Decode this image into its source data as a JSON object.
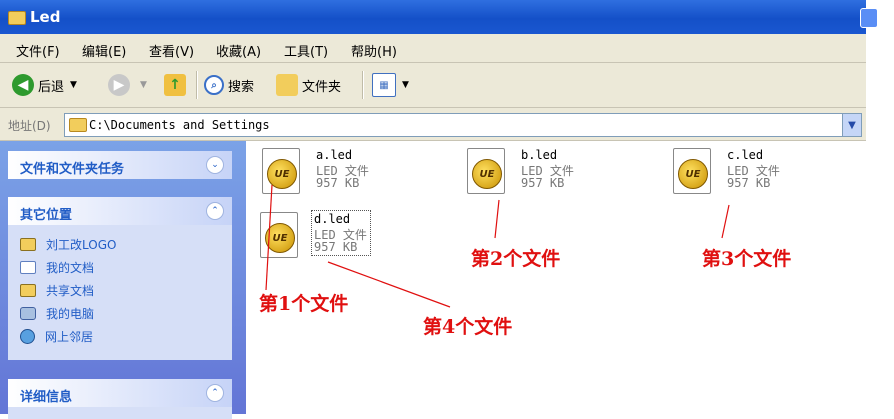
{
  "window": {
    "title": "Led"
  },
  "menu": [
    "文件(F)",
    "编辑(E)",
    "查看(V)",
    "收藏(A)",
    "工具(T)",
    "帮助(H)"
  ],
  "toolbar": {
    "back": "后退",
    "search": "搜索",
    "folders": "文件夹"
  },
  "address": {
    "label": "地址(D)",
    "value": "C:\\Documents and Settings"
  },
  "tasks": {
    "file_tasks": {
      "title": "文件和文件夹任务"
    },
    "other_places": {
      "title": "其它位置",
      "items": [
        "刘工改LOGO",
        "我的文档",
        "共享文档",
        "我的电脑",
        "网上邻居"
      ]
    },
    "details": {
      "title": "详细信息"
    }
  },
  "files": [
    {
      "name": "a.led",
      "type": "LED 文件",
      "size": "957 KB"
    },
    {
      "name": "b.led",
      "type": "LED 文件",
      "size": "957 KB"
    },
    {
      "name": "c.led",
      "type": "LED 文件",
      "size": "957 KB"
    },
    {
      "name": "d.led",
      "type": "LED 文件",
      "size": "957 KB"
    }
  ],
  "annotations": [
    "第1个文件",
    "第2个文件",
    "第3个文件",
    "第4个文件"
  ],
  "colors": {
    "annotation": "#e01010",
    "title_bar": "#1450c8",
    "task_link": "#215dc6"
  },
  "icons": {
    "file": "ue-gold-icon",
    "folder": "folder-icon"
  }
}
